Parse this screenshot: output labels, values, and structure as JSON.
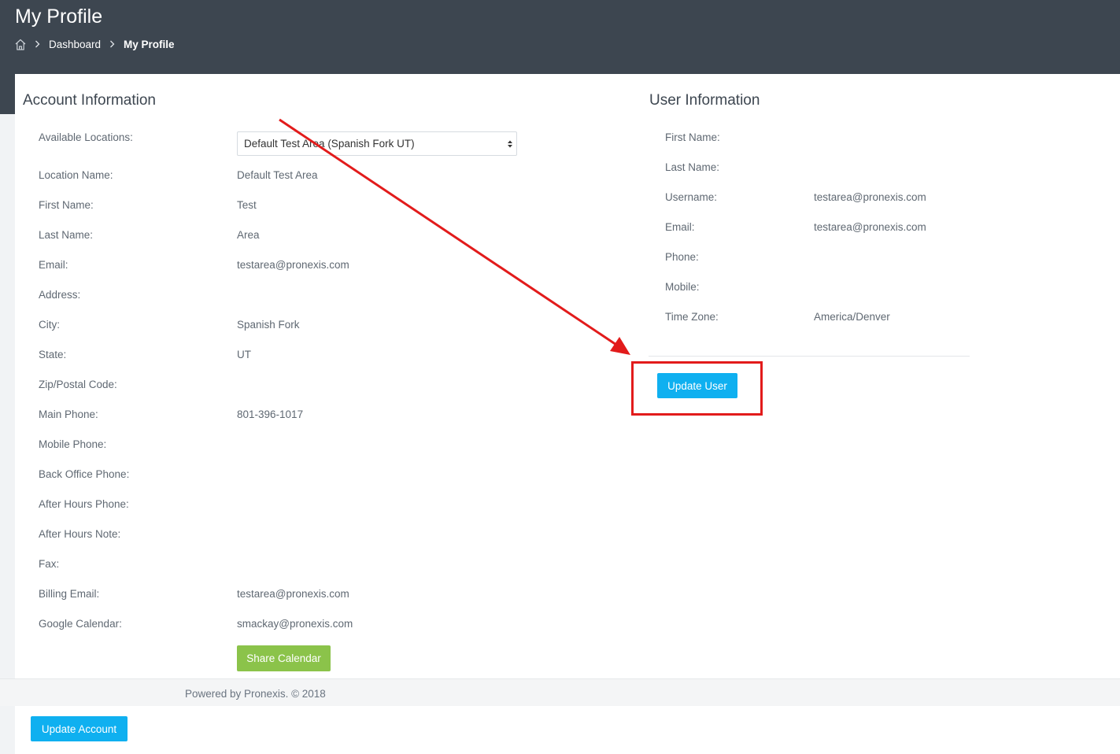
{
  "header": {
    "title": "My Profile",
    "breadcrumb": {
      "home_icon": "home-icon",
      "items": [
        "Dashboard",
        "My Profile"
      ]
    }
  },
  "account": {
    "title": "Account Information",
    "location_select_label": "Available Locations:",
    "location_select_value": "Default Test Area (Spanish Fork UT)",
    "rows": [
      {
        "label": "Location Name:",
        "value": "Default Test Area"
      },
      {
        "label": "First Name:",
        "value": "Test"
      },
      {
        "label": "Last Name:",
        "value": "Area"
      },
      {
        "label": "Email:",
        "value": "testarea@pronexis.com"
      },
      {
        "label": "Address:",
        "value": ""
      },
      {
        "label": "City:",
        "value": "Spanish Fork"
      },
      {
        "label": "State:",
        "value": "UT"
      },
      {
        "label": "Zip/Postal Code:",
        "value": ""
      },
      {
        "label": "Main Phone:",
        "value": "801-396-1017"
      },
      {
        "label": "Mobile Phone:",
        "value": ""
      },
      {
        "label": "Back Office Phone:",
        "value": ""
      },
      {
        "label": "After Hours Phone:",
        "value": ""
      },
      {
        "label": "After Hours Note:",
        "value": ""
      },
      {
        "label": "Fax:",
        "value": ""
      },
      {
        "label": "Billing Email:",
        "value": "testarea@pronexis.com"
      },
      {
        "label": "Google Calendar:",
        "value": "smackay@pronexis.com"
      }
    ],
    "share_calendar_label": "Share Calendar",
    "update_account_label": "Update Account"
  },
  "user": {
    "title": "User Information",
    "rows": [
      {
        "label": "First Name:",
        "value": ""
      },
      {
        "label": "Last Name:",
        "value": ""
      },
      {
        "label": "Username:",
        "value": "testarea@pronexis.com"
      },
      {
        "label": "Email:",
        "value": "testarea@pronexis.com"
      },
      {
        "label": "Phone:",
        "value": ""
      },
      {
        "label": "Mobile:",
        "value": ""
      },
      {
        "label": "Time Zone:",
        "value": "America/Denver"
      }
    ],
    "update_user_label": "Update User"
  },
  "footer": {
    "text": "Powered by Pronexis. © 2018"
  },
  "colors": {
    "header_bg": "#3d4650",
    "primary_button": "#0fb0f0",
    "success_button": "#8bc34a",
    "annotation": "#e21b1b"
  }
}
